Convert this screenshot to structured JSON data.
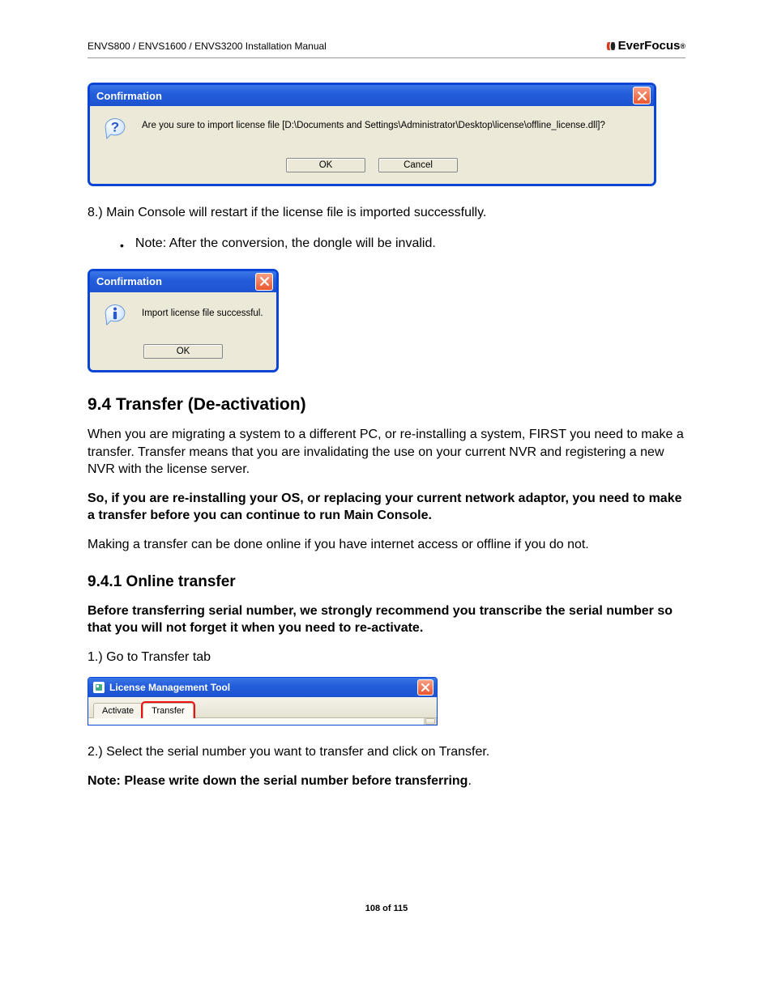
{
  "header": {
    "left": "ENVS800 / ENVS1600 / ENVS3200 Installation Manual",
    "brand_name": "EverFocus",
    "brand_reg": "®"
  },
  "dialog1": {
    "title": "Confirmation",
    "message": "Are you sure to import license file [D:\\Documents and Settings\\Administrator\\Desktop\\license\\offline_license.dll]?",
    "ok": "OK",
    "cancel": "Cancel"
  },
  "para_step8": "8.) Main Console will restart if the license file is imported successfully.",
  "bullet_note": "Note: After the conversion, the dongle will be invalid.",
  "dialog2": {
    "title": "Confirmation",
    "message": "Import license file successful.",
    "ok": "OK"
  },
  "section_94": "9.4   Transfer (De-activation)",
  "para_94_1": "When you are migrating a system to a different PC, or re-installing a system, FIRST you need to make a transfer. Transfer means that you are invalidating the use on your current NVR and registering a new NVR with the license server.",
  "para_94_2": "So, if you are re-installing your OS, or replacing your current network adaptor, you need to make a transfer before you can continue to run Main Console.",
  "para_94_3": "Making a transfer can be done online if you have internet access or offline if you do not.",
  "section_941": "9.4.1 Online transfer",
  "para_941_1": "Before transferring serial number, we strongly recommend you transcribe the serial number so that you will not forget it when you need to re-activate.",
  "para_941_2": "1.) Go to Transfer tab",
  "lmt": {
    "title": "License Management Tool",
    "tab_activate": "Activate",
    "tab_transfer": "Transfer"
  },
  "para_941_3": "2.) Select the serial number you want to transfer and click on Transfer.",
  "para_941_4a": "Note: Please write down the serial number before transferring",
  "para_941_4b": ".",
  "footer": "108 of 115"
}
